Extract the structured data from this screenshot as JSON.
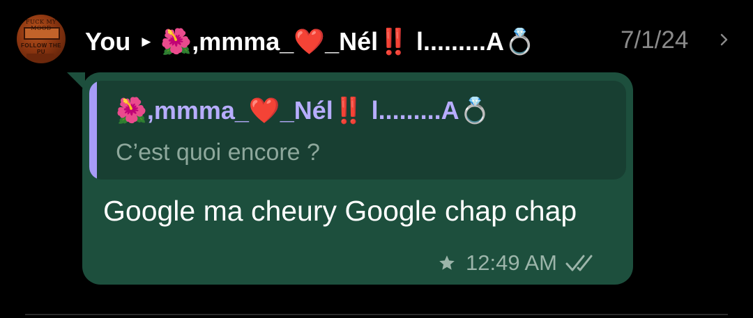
{
  "header": {
    "sender": "You",
    "chat_name_prefix": "🌺",
    "chat_name": ",mmma_",
    "chat_name_heart": "❤️",
    "chat_name_mid": "_Nél",
    "chat_name_bang": "‼️",
    "chat_name_tail": " l.........A",
    "chat_name_ring": "💍",
    "date": "7/1/24",
    "arrow_icon": "triangle-right",
    "chevron_icon": "chevron-right"
  },
  "avatar": {
    "line1": "FUCK MY MOOD",
    "line2": "FOLLOW THE PU"
  },
  "quote": {
    "author_prefix": "🌺",
    "author": ",mmma_",
    "author_heart": "❤️",
    "author_mid": "_Nél",
    "author_bang": "‼️",
    "author_tail": " l.........A",
    "author_ring": "💍",
    "text": "C’est quoi encore ?"
  },
  "message": {
    "text": "Google ma cheury Google chap chap",
    "time": "12:49 AM",
    "starred": true,
    "status": "read"
  },
  "colors": {
    "background": "#000000",
    "bubble": "#1d4f3d",
    "quote_bg": "#183f32",
    "quote_bar": "#a79cf6",
    "quote_name": "#b7adff",
    "meta": "#9cb5aa"
  }
}
